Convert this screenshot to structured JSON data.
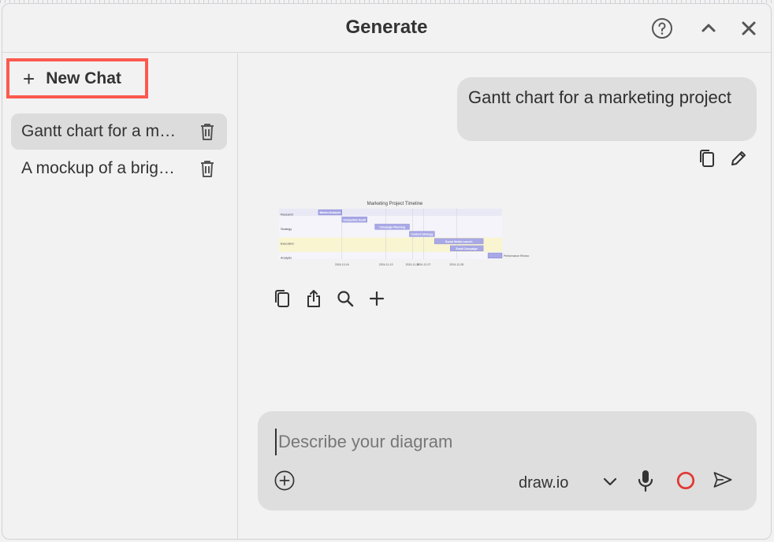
{
  "window": {
    "title": "Generate",
    "icons": {
      "help": "help-circle-icon",
      "collapse": "chevron-up-icon",
      "close": "close-icon"
    }
  },
  "sidebar": {
    "new_chat_label": "New Chat",
    "new_chat_icon": "plus-icon",
    "highlight_color": "#fb5a4e",
    "history": [
      {
        "label": "Gantt chart for a m…",
        "active": true
      },
      {
        "label": "A mockup of a brig…",
        "active": false
      }
    ]
  },
  "conversation": {
    "user_message": "Gantt chart for a marketing project",
    "message_actions": [
      "copy-icon",
      "edit-pencil-icon"
    ],
    "result_actions": [
      "copy-icon",
      "share-icon",
      "zoom-icon",
      "insert-plus-icon"
    ],
    "chart_data": {
      "type": "gantt",
      "title": "Marketing Project Timeline",
      "sections": [
        "Research",
        "Strategy",
        "Execution",
        "Analysis"
      ],
      "tasks": [
        {
          "section": "Research",
          "name": "Market Analysis",
          "start": "2024-10-01",
          "end": "2024-10-16"
        },
        {
          "section": "Research",
          "name": "Competitor Audit",
          "start": "2024-10-16",
          "end": "2024-11-01"
        },
        {
          "section": "Strategy",
          "name": "Campaign Planning",
          "start": "2024-11-06",
          "end": "2024-11-28"
        },
        {
          "section": "Strategy",
          "name": "Content Strategy",
          "start": "2024-11-28",
          "end": "2024-12-14"
        },
        {
          "section": "Execution",
          "name": "Social Media Launch",
          "start": "2024-12-14",
          "end": "2025-01-14"
        },
        {
          "section": "Execution",
          "name": "Email Campaign",
          "start": "2024-12-24",
          "end": "2025-01-14"
        },
        {
          "section": "Analysis",
          "name": "Performance Review",
          "start": "2025-01-17",
          "end": "2025-01-26"
        }
      ],
      "x_ticks": [
        "2024-10-16",
        "2024-11-13",
        "2024-11-30",
        "2024-12-07",
        "2024-12-28"
      ],
      "colors": {
        "bar": "#a8a8e6",
        "bar_border": "#7b7bd1",
        "band_light": "#e9e9f6",
        "band_dark": "#f4f4fa",
        "band_yellow": "#f8f5d0"
      }
    }
  },
  "composer": {
    "placeholder": "Describe your diagram",
    "engine": "draw.io",
    "icons": [
      "attach-plus-icon",
      "chevron-down-icon",
      "microphone-icon",
      "record-icon",
      "send-icon"
    ],
    "record_color": "#e03a35"
  }
}
